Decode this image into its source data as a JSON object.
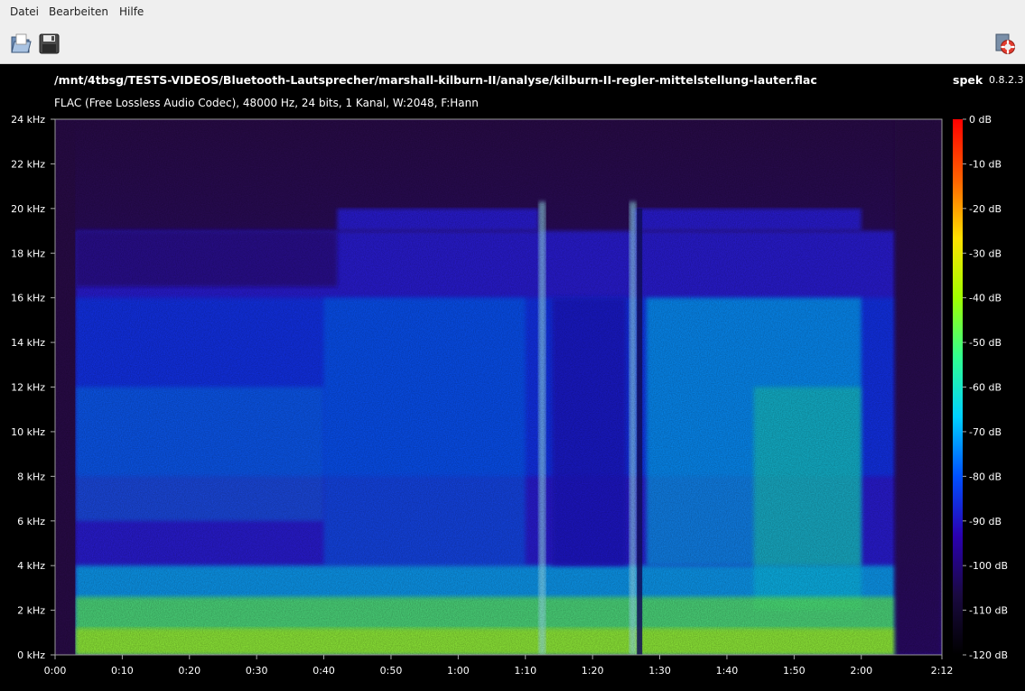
{
  "menu": {
    "file": "Datei",
    "edit": "Bearbeiten",
    "help": "Hilfe"
  },
  "toolbar": {
    "open_icon": "open-file-icon",
    "save_icon": "save-icon",
    "about_icon": "lifebuoy-icon"
  },
  "header": {
    "file_path": "/mnt/4tbsg/TESTS-VIDEOS/Bluetooth-Lautsprecher/marshall-kilburn-II/analyse/kilburn-II-regler-mittelstellung-lauter.flac",
    "app_name": "spek",
    "app_version": "0.8.2.3",
    "file_info": "FLAC (Free Lossless Audio Codec), 48000 Hz, 24 bits, 1 Kanal, W:2048, F:Hann"
  },
  "colors": {
    "background": "#000000",
    "chrome": "#efefef",
    "cutoff_band": "#2a1fd6",
    "noise_floor": "#2a0b4a"
  },
  "chart_data": {
    "type": "heatmap",
    "xlabel": "",
    "ylabel": "",
    "x_ticks": [
      "0:00",
      "0:10",
      "0:20",
      "0:30",
      "0:40",
      "0:50",
      "1:00",
      "1:10",
      "1:20",
      "1:30",
      "1:40",
      "1:50",
      "2:00",
      "2:12"
    ],
    "x_tick_seconds": [
      0,
      10,
      20,
      30,
      40,
      50,
      60,
      70,
      80,
      90,
      100,
      110,
      120,
      132
    ],
    "y_ticks": [
      "0 kHz",
      "2 kHz",
      "4 kHz",
      "6 kHz",
      "8 kHz",
      "10 kHz",
      "12 kHz",
      "14 kHz",
      "16 kHz",
      "18 kHz",
      "20 kHz",
      "22 kHz",
      "24 kHz"
    ],
    "y_tick_khz": [
      0,
      2,
      4,
      6,
      8,
      10,
      12,
      14,
      16,
      18,
      20,
      22,
      24
    ],
    "xlim": [
      0,
      132
    ],
    "ylim": [
      0,
      24
    ],
    "colorbar_ticks": [
      "0 dB",
      "-10 dB",
      "-20 dB",
      "-30 dB",
      "-40 dB",
      "-50 dB",
      "-60 dB",
      "-70 dB",
      "-80 dB",
      "-90 dB",
      "-100 dB",
      "-110 dB",
      "-120 dB"
    ],
    "colorbar_db": [
      0,
      -10,
      -20,
      -30,
      -40,
      -50,
      -60,
      -70,
      -80,
      -90,
      -100,
      -110,
      -120
    ],
    "colorbar_range": [
      -120,
      0
    ],
    "colormap": [
      "#000000",
      "#1a0a40",
      "#2a00b0",
      "#0050ff",
      "#00d0ff",
      "#30ff90",
      "#a0ff00",
      "#ffe000",
      "#ff6000",
      "#ff0000"
    ],
    "cutoff_khz": 20,
    "silence_end_s": 3
  }
}
